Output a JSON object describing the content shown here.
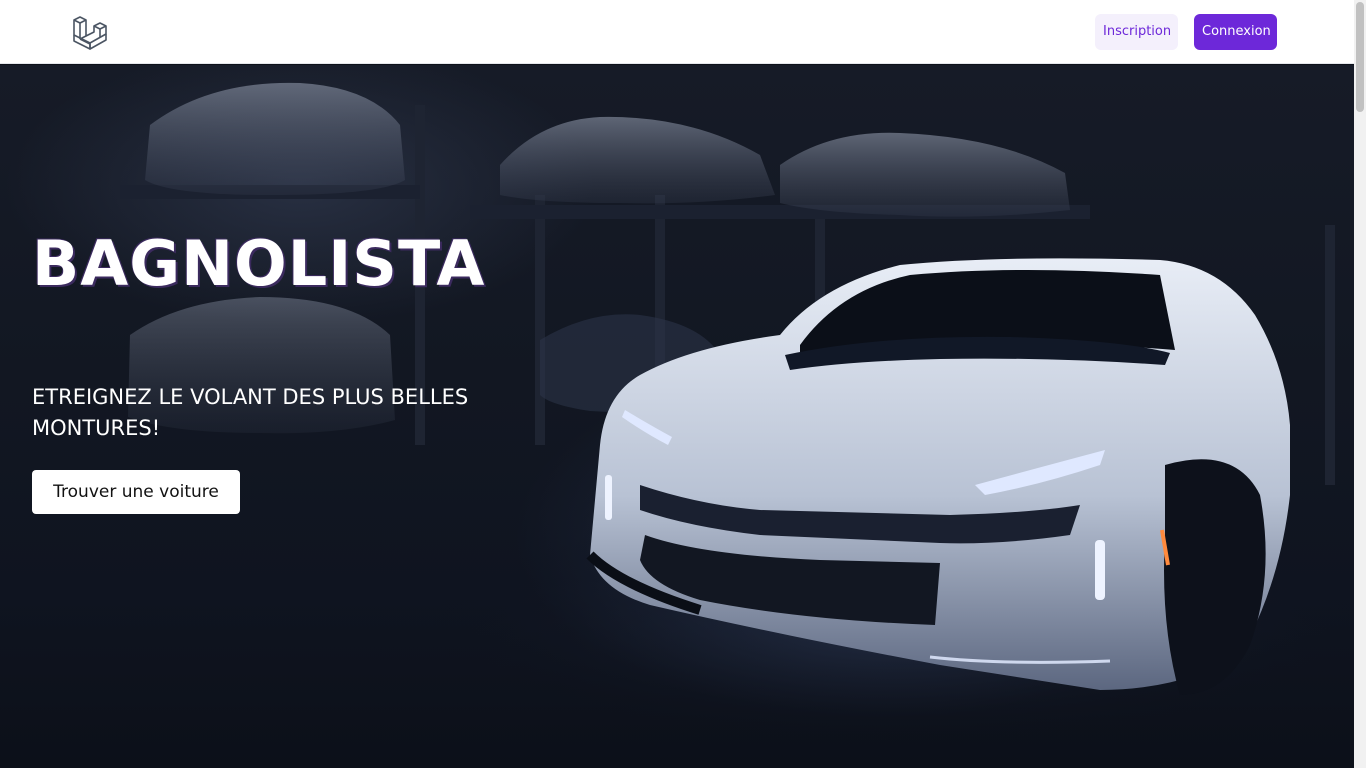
{
  "navbar": {
    "logo_icon": "laravel-logo-icon",
    "register_label": "Inscription",
    "login_label": "Connexion",
    "accent_color": "#6d28d9"
  },
  "hero": {
    "title": "BAGNOLISTA",
    "tagline": "ETREIGNEZ LE VOLANT DES PLUS BELLES MONTURES!",
    "cta_label": "Trouver une voiture",
    "background_image": "sports-car-garage-photo"
  }
}
